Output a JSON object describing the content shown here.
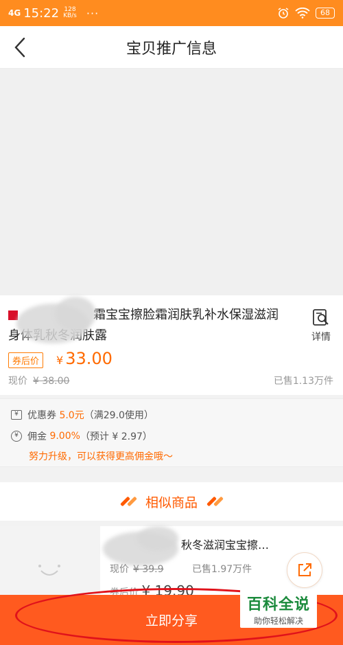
{
  "status_bar": {
    "signal": "4G",
    "time": "15:22",
    "net_speed": "128",
    "net_unit": "KB/s",
    "more": "···",
    "battery": "68"
  },
  "header": {
    "title": "宝贝推广信息"
  },
  "product": {
    "title": "霜宝宝擦脸霜润肤乳补水保湿滋润身体乳秋冬润肤露",
    "detail_label": "详情",
    "coupon_tag": "券后价",
    "currency": "¥",
    "coupon_price": "33.00",
    "current_label": "现价",
    "original_price": "¥ 38.00",
    "sold": "已售1.13万件"
  },
  "benefits": {
    "coupon_label": "优惠券",
    "coupon_value": "5.0元",
    "coupon_condition": "（满29.0使用）",
    "commission_label": "佣金",
    "commission_rate": "9.00%",
    "commission_estimate": "（预计 ¥ 2.97）",
    "upgrade_hint": "努力升级，可以获得更高佣金哦～"
  },
  "similar": {
    "heading": "相似商品",
    "item_title": "秋冬滋润宝宝擦…",
    "item_current_label": "现价",
    "item_original_price": "¥ 39.9",
    "item_sold": "已售1.97万件",
    "item_coupon_label": "券后价",
    "item_coupon_price": "¥ 19.90"
  },
  "share_button": {
    "label": "立即分享"
  },
  "watermark": {
    "title": "百科全说",
    "subtitle": "助你轻松解决"
  },
  "colors": {
    "status_bar": "#ff8c1f",
    "accent": "#ff6a00",
    "share_bar": "#ff5a1f",
    "annotation_ring": "#e0121b"
  }
}
